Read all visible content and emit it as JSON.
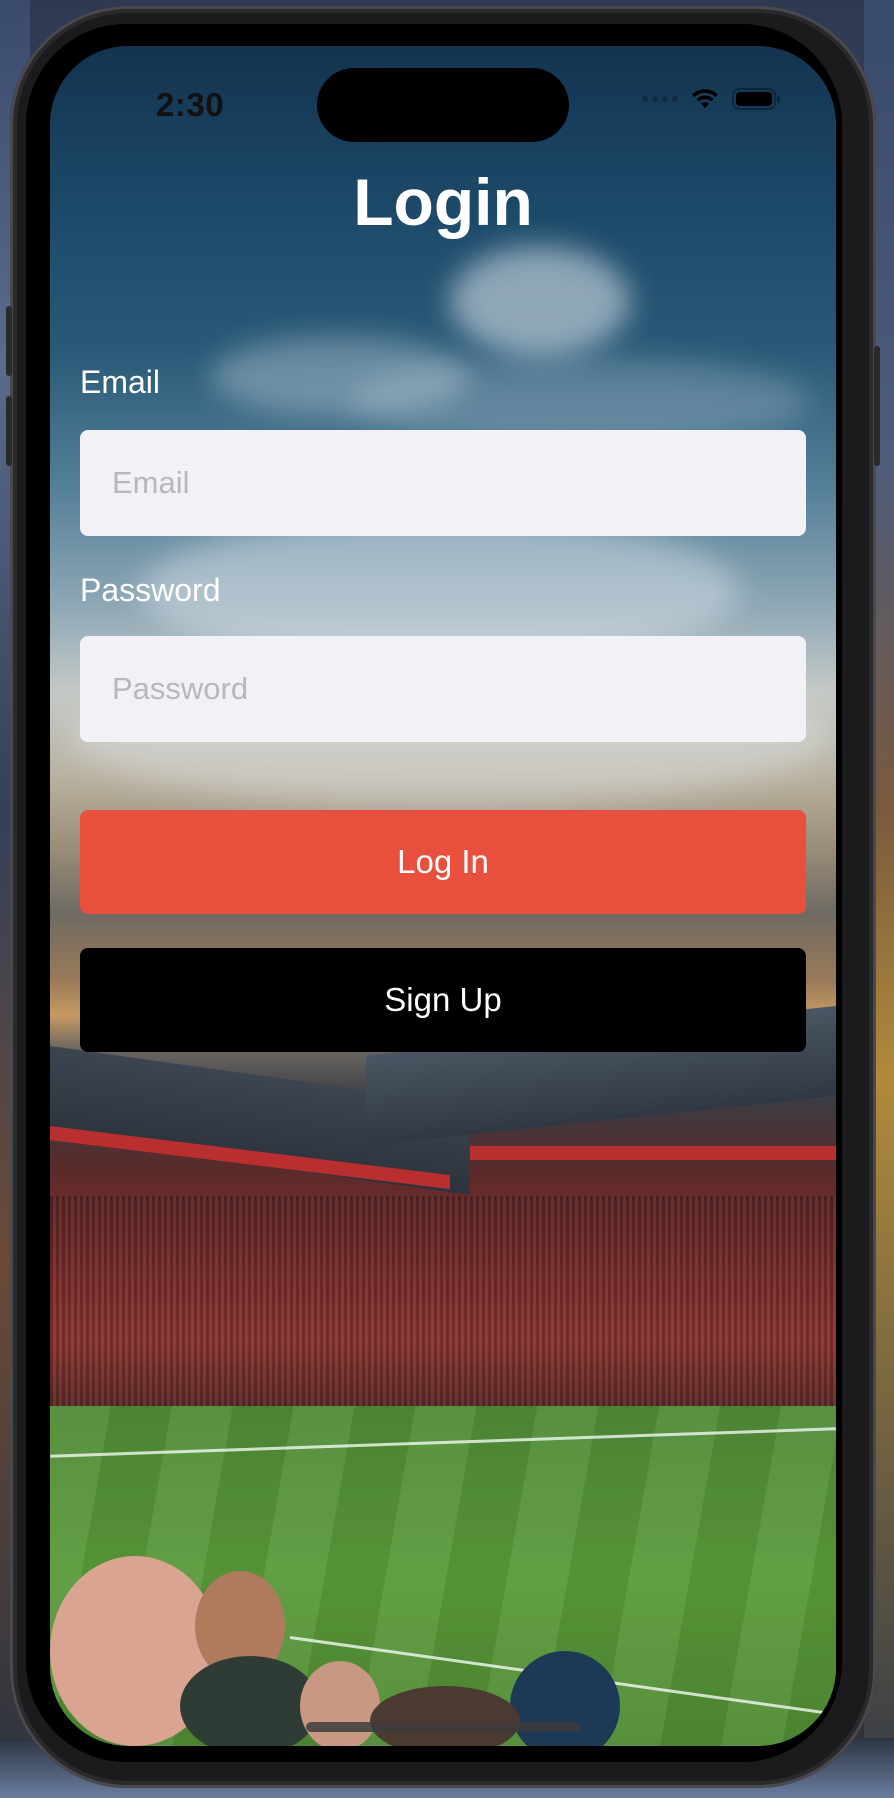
{
  "status_bar": {
    "time": "2:30",
    "icons": [
      "signal-dots-icon",
      "wifi-icon",
      "battery-icon"
    ]
  },
  "screen": {
    "title": "Login",
    "background_image": "stadium-sky-photo"
  },
  "form": {
    "email": {
      "label": "Email",
      "placeholder": "Email",
      "value": ""
    },
    "password": {
      "label": "Password",
      "placeholder": "Password",
      "value": ""
    }
  },
  "buttons": {
    "login_label": "Log In",
    "signup_label": "Sign Up"
  },
  "colors": {
    "login_button": "#e94f3d",
    "signup_button": "#000000",
    "input_background": "#f2f1f6",
    "title_text": "#ffffff"
  }
}
